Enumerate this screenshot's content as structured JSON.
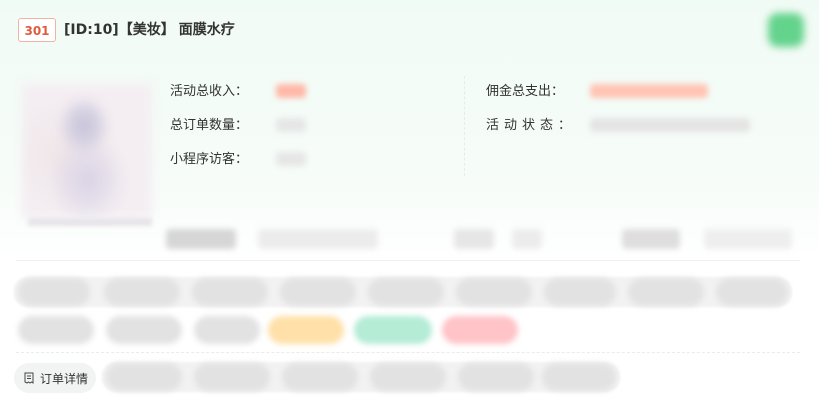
{
  "header": {
    "badge": "301",
    "id_category": "[ID:10]【美妆】",
    "product_name": "面膜水疗"
  },
  "stats": {
    "total_revenue_label": "活动总收入：",
    "total_orders_label": "总订单数量：",
    "mini_program_visitors_label": "小程序访客：",
    "total_commission_label": "佣金总支出：",
    "activity_status_label": "活动状态："
  },
  "actions": {
    "order_detail_label": "订单详情",
    "order_detail_icon": "receipt-icon"
  },
  "colors": {
    "badge_text": "#e25a3b",
    "badge_border": "#f3b2a4",
    "corner_button": "#64d38c",
    "revenue_blur": "#ffb8a8",
    "commission_blur": "#ffc4b4",
    "pill_yellow": "#ffe0a8",
    "pill_green": "#b4ecd6",
    "pill_red": "#ffc4c8"
  }
}
